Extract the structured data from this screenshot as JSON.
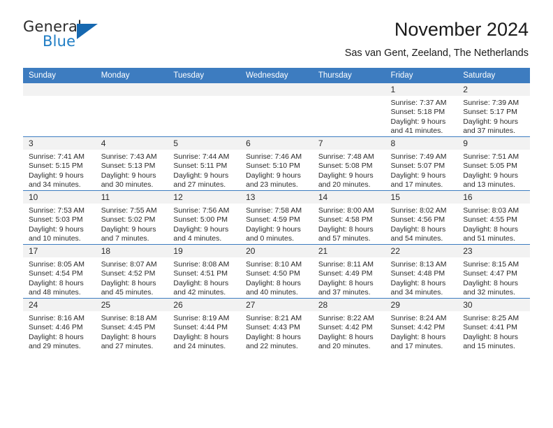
{
  "brand": {
    "name_part1": "General",
    "name_part2": "Blue",
    "logo_icon": "triangle-logo-icon",
    "accent_color": "#1f7dc4"
  },
  "header": {
    "title": "November 2024",
    "subtitle": "Sas van Gent, Zeeland, The Netherlands"
  },
  "calendar": {
    "header_bg_color": "#3d7cc0",
    "daynum_bg_color": "#f2f2f2",
    "columns": [
      "Sunday",
      "Monday",
      "Tuesday",
      "Wednesday",
      "Thursday",
      "Friday",
      "Saturday"
    ],
    "weeks": [
      [
        {
          "day": "",
          "lines": []
        },
        {
          "day": "",
          "lines": []
        },
        {
          "day": "",
          "lines": []
        },
        {
          "day": "",
          "lines": []
        },
        {
          "day": "",
          "lines": []
        },
        {
          "day": "1",
          "lines": [
            "Sunrise: 7:37 AM",
            "Sunset: 5:18 PM",
            "Daylight: 9 hours",
            "and 41 minutes."
          ]
        },
        {
          "day": "2",
          "lines": [
            "Sunrise: 7:39 AM",
            "Sunset: 5:17 PM",
            "Daylight: 9 hours",
            "and 37 minutes."
          ]
        }
      ],
      [
        {
          "day": "3",
          "lines": [
            "Sunrise: 7:41 AM",
            "Sunset: 5:15 PM",
            "Daylight: 9 hours",
            "and 34 minutes."
          ]
        },
        {
          "day": "4",
          "lines": [
            "Sunrise: 7:43 AM",
            "Sunset: 5:13 PM",
            "Daylight: 9 hours",
            "and 30 minutes."
          ]
        },
        {
          "day": "5",
          "lines": [
            "Sunrise: 7:44 AM",
            "Sunset: 5:11 PM",
            "Daylight: 9 hours",
            "and 27 minutes."
          ]
        },
        {
          "day": "6",
          "lines": [
            "Sunrise: 7:46 AM",
            "Sunset: 5:10 PM",
            "Daylight: 9 hours",
            "and 23 minutes."
          ]
        },
        {
          "day": "7",
          "lines": [
            "Sunrise: 7:48 AM",
            "Sunset: 5:08 PM",
            "Daylight: 9 hours",
            "and 20 minutes."
          ]
        },
        {
          "day": "8",
          "lines": [
            "Sunrise: 7:49 AM",
            "Sunset: 5:07 PM",
            "Daylight: 9 hours",
            "and 17 minutes."
          ]
        },
        {
          "day": "9",
          "lines": [
            "Sunrise: 7:51 AM",
            "Sunset: 5:05 PM",
            "Daylight: 9 hours",
            "and 13 minutes."
          ]
        }
      ],
      [
        {
          "day": "10",
          "lines": [
            "Sunrise: 7:53 AM",
            "Sunset: 5:03 PM",
            "Daylight: 9 hours",
            "and 10 minutes."
          ]
        },
        {
          "day": "11",
          "lines": [
            "Sunrise: 7:55 AM",
            "Sunset: 5:02 PM",
            "Daylight: 9 hours",
            "and 7 minutes."
          ]
        },
        {
          "day": "12",
          "lines": [
            "Sunrise: 7:56 AM",
            "Sunset: 5:00 PM",
            "Daylight: 9 hours",
            "and 4 minutes."
          ]
        },
        {
          "day": "13",
          "lines": [
            "Sunrise: 7:58 AM",
            "Sunset: 4:59 PM",
            "Daylight: 9 hours",
            "and 0 minutes."
          ]
        },
        {
          "day": "14",
          "lines": [
            "Sunrise: 8:00 AM",
            "Sunset: 4:58 PM",
            "Daylight: 8 hours",
            "and 57 minutes."
          ]
        },
        {
          "day": "15",
          "lines": [
            "Sunrise: 8:02 AM",
            "Sunset: 4:56 PM",
            "Daylight: 8 hours",
            "and 54 minutes."
          ]
        },
        {
          "day": "16",
          "lines": [
            "Sunrise: 8:03 AM",
            "Sunset: 4:55 PM",
            "Daylight: 8 hours",
            "and 51 minutes."
          ]
        }
      ],
      [
        {
          "day": "17",
          "lines": [
            "Sunrise: 8:05 AM",
            "Sunset: 4:54 PM",
            "Daylight: 8 hours",
            "and 48 minutes."
          ]
        },
        {
          "day": "18",
          "lines": [
            "Sunrise: 8:07 AM",
            "Sunset: 4:52 PM",
            "Daylight: 8 hours",
            "and 45 minutes."
          ]
        },
        {
          "day": "19",
          "lines": [
            "Sunrise: 8:08 AM",
            "Sunset: 4:51 PM",
            "Daylight: 8 hours",
            "and 42 minutes."
          ]
        },
        {
          "day": "20",
          "lines": [
            "Sunrise: 8:10 AM",
            "Sunset: 4:50 PM",
            "Daylight: 8 hours",
            "and 40 minutes."
          ]
        },
        {
          "day": "21",
          "lines": [
            "Sunrise: 8:11 AM",
            "Sunset: 4:49 PM",
            "Daylight: 8 hours",
            "and 37 minutes."
          ]
        },
        {
          "day": "22",
          "lines": [
            "Sunrise: 8:13 AM",
            "Sunset: 4:48 PM",
            "Daylight: 8 hours",
            "and 34 minutes."
          ]
        },
        {
          "day": "23",
          "lines": [
            "Sunrise: 8:15 AM",
            "Sunset: 4:47 PM",
            "Daylight: 8 hours",
            "and 32 minutes."
          ]
        }
      ],
      [
        {
          "day": "24",
          "lines": [
            "Sunrise: 8:16 AM",
            "Sunset: 4:46 PM",
            "Daylight: 8 hours",
            "and 29 minutes."
          ]
        },
        {
          "day": "25",
          "lines": [
            "Sunrise: 8:18 AM",
            "Sunset: 4:45 PM",
            "Daylight: 8 hours",
            "and 27 minutes."
          ]
        },
        {
          "day": "26",
          "lines": [
            "Sunrise: 8:19 AM",
            "Sunset: 4:44 PM",
            "Daylight: 8 hours",
            "and 24 minutes."
          ]
        },
        {
          "day": "27",
          "lines": [
            "Sunrise: 8:21 AM",
            "Sunset: 4:43 PM",
            "Daylight: 8 hours",
            "and 22 minutes."
          ]
        },
        {
          "day": "28",
          "lines": [
            "Sunrise: 8:22 AM",
            "Sunset: 4:42 PM",
            "Daylight: 8 hours",
            "and 20 minutes."
          ]
        },
        {
          "day": "29",
          "lines": [
            "Sunrise: 8:24 AM",
            "Sunset: 4:42 PM",
            "Daylight: 8 hours",
            "and 17 minutes."
          ]
        },
        {
          "day": "30",
          "lines": [
            "Sunrise: 8:25 AM",
            "Sunset: 4:41 PM",
            "Daylight: 8 hours",
            "and 15 minutes."
          ]
        }
      ]
    ]
  }
}
